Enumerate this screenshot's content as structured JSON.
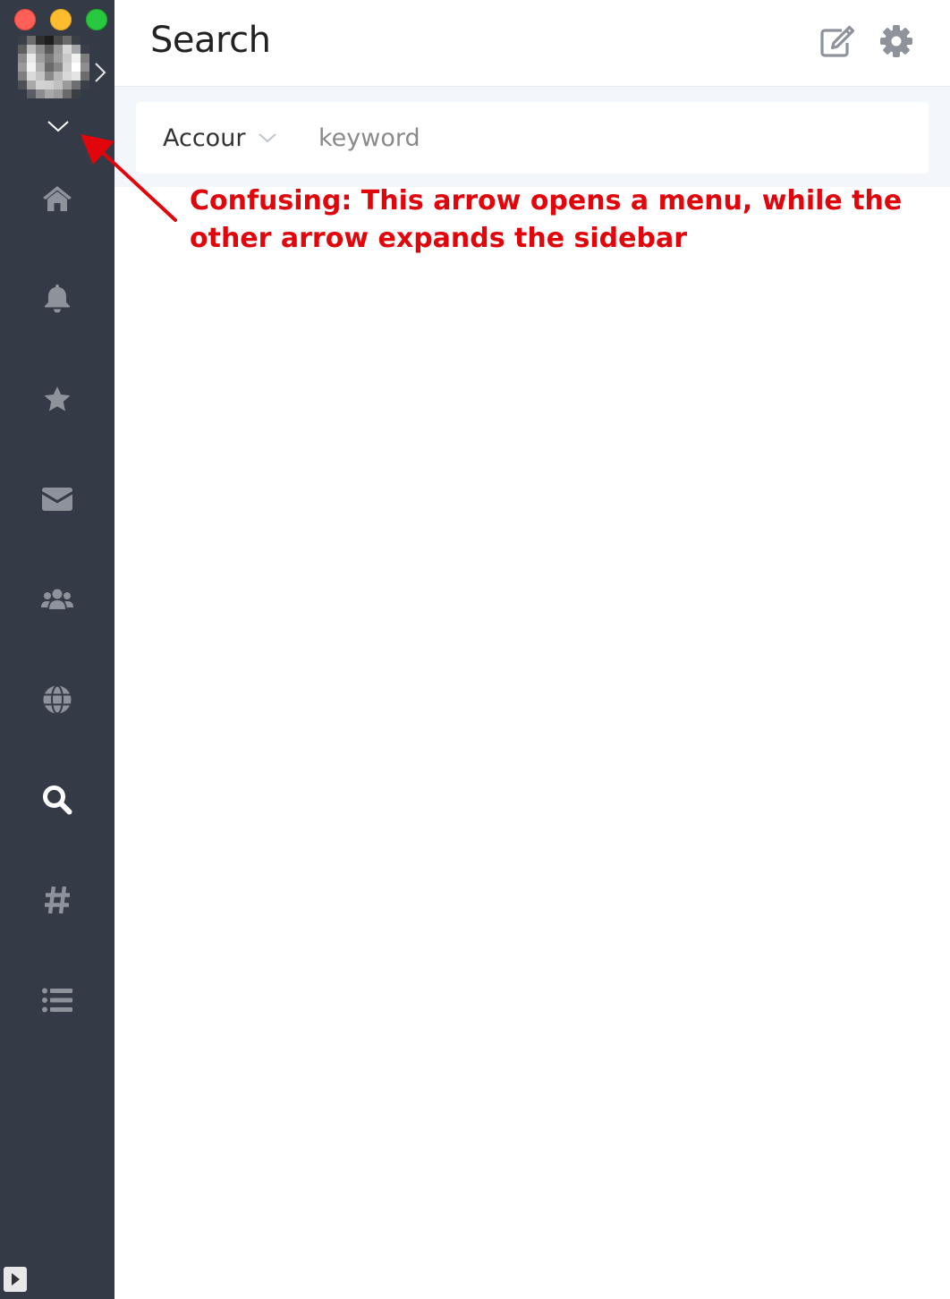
{
  "window": {
    "controls": [
      "close",
      "minimize",
      "maximize"
    ]
  },
  "sidebar": {
    "expand_icon": "chevron-right-icon",
    "menu_icon": "chevron-down-icon",
    "items": [
      {
        "id": "home",
        "icon": "home-icon",
        "active": false
      },
      {
        "id": "notifications",
        "icon": "bell-icon",
        "active": false
      },
      {
        "id": "favorites",
        "icon": "star-icon",
        "active": false
      },
      {
        "id": "messages",
        "icon": "envelope-icon",
        "active": false
      },
      {
        "id": "people",
        "icon": "users-icon",
        "active": false
      },
      {
        "id": "explore",
        "icon": "globe-icon",
        "active": false
      },
      {
        "id": "search",
        "icon": "search-icon",
        "active": true
      },
      {
        "id": "hashtags",
        "icon": "hashtag-icon",
        "active": false
      },
      {
        "id": "lists",
        "icon": "list-icon",
        "active": false
      }
    ],
    "bottom_toggle_icon": "play-icon"
  },
  "header": {
    "title": "Search",
    "compose_icon": "compose-icon",
    "settings_icon": "gear-icon"
  },
  "search": {
    "account_label": "Accour",
    "keyword_placeholder": "keyword",
    "keyword_value": ""
  },
  "annotation": {
    "text": "Confusing: This arrow opens a menu, while the other arrow expands the sidebar",
    "color": "#e0060c"
  },
  "colors": {
    "sidebar_bg": "#343a46",
    "icon_gray": "#8d929b",
    "icon_active": "#ffffff",
    "search_band": "#f3f6fb"
  }
}
